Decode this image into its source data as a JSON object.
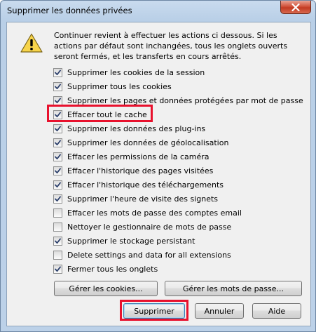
{
  "window": {
    "title": "Supprimer les données privées"
  },
  "warning": {
    "description": "Continuer revient à effectuer les actions ci dessous. Si les actions par défaut sont inchangées, tous les onglets ouverts seront fermés, et les transferts en cours arrêtés."
  },
  "options": [
    {
      "label": "Supprimer les cookies de la session",
      "checked": true
    },
    {
      "label": "Supprimer tous les cookies",
      "checked": true
    },
    {
      "label": "Supprimer les pages et données protégées par mot de passe",
      "checked": true
    },
    {
      "label": "Effacer tout le cache",
      "checked": true
    },
    {
      "label": "Supprimer les données des plug-ins",
      "checked": true
    },
    {
      "label": "Supprimer les données de géolocalisation",
      "checked": true
    },
    {
      "label": "Effacer les permissions de la caméra",
      "checked": true
    },
    {
      "label": "Effacer l'historique des pages visitées",
      "checked": true
    },
    {
      "label": "Effacer l'historique des téléchargements",
      "checked": true
    },
    {
      "label": "Supprimer l'heure de visite des signets",
      "checked": true
    },
    {
      "label": "Effacer les mots de passe des comptes email",
      "checked": false
    },
    {
      "label": "Nettoyer le gestionnaire de mots de passe",
      "checked": false
    },
    {
      "label": "Supprimer le stockage persistant",
      "checked": true
    },
    {
      "label": "Delete settings and data for all extensions",
      "checked": false
    },
    {
      "label": "Fermer tous les onglets",
      "checked": true
    }
  ],
  "buttons": {
    "manage_cookies": "Gérer les cookies...",
    "manage_passwords": "Gérer les mots de passe...",
    "delete": "Supprimer",
    "cancel": "Annuler",
    "help": "Aide"
  },
  "colors": {
    "highlight": "#e8112d"
  }
}
